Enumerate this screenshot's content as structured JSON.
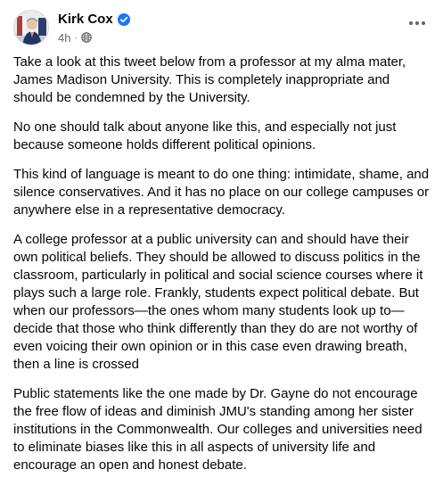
{
  "post": {
    "author": "Kirk Cox",
    "time": "4h",
    "separator": "·",
    "icons": {
      "verified": "verified-badge-icon",
      "privacy": "globe-icon",
      "more": "more-options-icon",
      "accent": "#1877f2"
    },
    "paragraphs": [
      "Take a look at this tweet below from a professor at my alma mater, James Madison University. This is completely inappropriate and should be condemned by the University.",
      "No one should talk about anyone like this, and especially not just because someone holds different political opinions.",
      "This kind of language is meant to do one thing: intimidate, shame, and silence conservatives. And it has no place on our college campuses or anywhere else in a representative democracy.",
      "A college professor at a public university can and should have their own political beliefs. They should be allowed to discuss politics in the classroom, particularly in political and social science courses where it plays such a large role. Frankly, students expect political debate. But when our professors—the ones whom many students look up to—decide that those who think differently than they do are not worthy of even voicing their own opinion or in this case even drawing breath, then a line is crossed",
      "Public statements like the one made by Dr. Gayne do not encourage the free flow of ideas and diminish JMU's standing among her sister institutions in the Commonwealth. Our colleges and universities need to eliminate biases like this in all aspects of university life and encourage an open and honest debate."
    ]
  }
}
